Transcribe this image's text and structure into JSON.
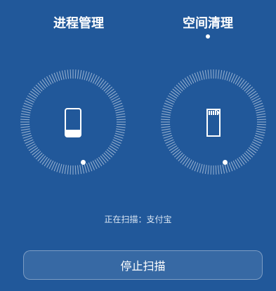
{
  "tabs": {
    "process": "进程管理",
    "space": "空间清理",
    "active": "space"
  },
  "status": {
    "scanning_text": "正在扫描：支付宝"
  },
  "actions": {
    "stop_scan": "停止扫描"
  },
  "icons": {
    "process_dial": "phone-memory-icon",
    "space_dial": "sd-card-icon"
  },
  "colors": {
    "background": "#21589a",
    "foreground": "#ffffff"
  }
}
